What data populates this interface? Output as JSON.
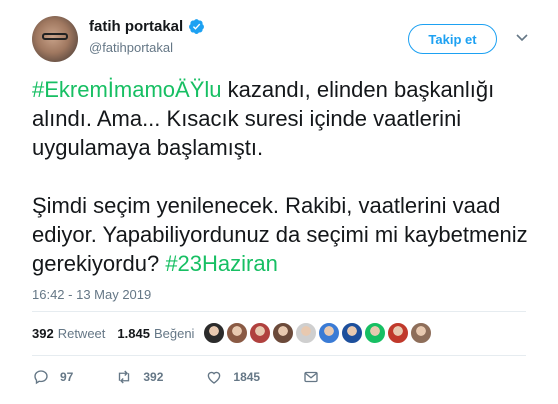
{
  "author": {
    "display_name": "fatih portakal",
    "handle": "@fatihportakal",
    "verified": true
  },
  "header": {
    "follow_label": "Takip et"
  },
  "tweet": {
    "paragraph1": [
      {
        "text": "#EkremİmamoÄŸlu",
        "type": "hashtag"
      },
      {
        "text": " kazandı, elinden başkanlığı alındı. Ama... Kısacık suresi içinde vaatlerini uygulamaya başlamıştı.",
        "type": "text"
      }
    ],
    "paragraph2": [
      {
        "text": "Şimdi seçim yenilenecek. Rakibi, vaatlerini vaad ediyor. Yapabiliyordunuz da seçimi mi kaybetmeniz gerekiyordu? ",
        "type": "text"
      },
      {
        "text": "#23Haziran",
        "type": "hashtag"
      }
    ],
    "timestamp": "16:42 - 13 May 2019"
  },
  "stats": {
    "retweet_count": "392",
    "retweet_label": "Retweet",
    "like_count": "1.845",
    "like_label": "Beğeni"
  },
  "likers": [
    {
      "color": "#2b2b2b"
    },
    {
      "color": "#8a5a44"
    },
    {
      "color": "#b0413e"
    },
    {
      "color": "#6b4a3a"
    },
    {
      "color": "#cfcfcf"
    },
    {
      "color": "#3a7bd5"
    },
    {
      "color": "#1d4f9c"
    },
    {
      "color": "#17bf63"
    },
    {
      "color": "#c0392b"
    },
    {
      "color": "#8e6e5a"
    }
  ],
  "actions": {
    "reply_count": "97",
    "retweet_count": "392",
    "like_count": "1845"
  },
  "colors": {
    "accent": "#1da1f2",
    "hashtag": "#17bf63",
    "muted": "#657786",
    "text": "#14171a"
  }
}
